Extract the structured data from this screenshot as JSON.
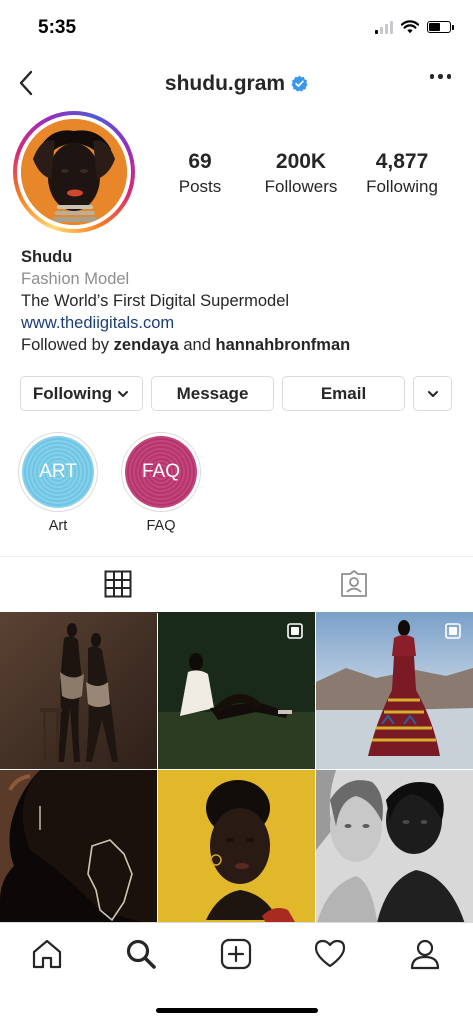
{
  "status_bar": {
    "time": "5:35"
  },
  "header": {
    "username": "shudu.gram",
    "verified": true,
    "back_icon": "chevron-left-icon",
    "more_icon": "more-horizontal-icon"
  },
  "profile": {
    "stats": [
      {
        "value": "69",
        "label": "Posts"
      },
      {
        "value": "200K",
        "label": "Followers"
      },
      {
        "value": "4,877",
        "label": "Following"
      }
    ],
    "name": "Shudu",
    "category": "Fashion Model",
    "bio": "The World’s First Digital Supermodel",
    "website": "www.thediigitals.com",
    "followed_by": {
      "prefix": "Followed by",
      "user1": "zendaya",
      "joiner": "and",
      "user2": "hannahbronfman"
    }
  },
  "actions": {
    "following": "Following",
    "message": "Message",
    "email": "Email"
  },
  "highlights": [
    {
      "cover_text": "ART",
      "label": "Art",
      "color": "#66c1e0"
    },
    {
      "cover_text": "FAQ",
      "label": "FAQ",
      "color": "#b8366e"
    }
  ],
  "tabs": [
    {
      "icon": "grid-icon",
      "active": true
    },
    {
      "icon": "tagged-icon",
      "active": false
    }
  ],
  "bottom_nav": [
    "home-icon",
    "search-icon",
    "new-post-icon",
    "activity-heart-icon",
    "profile-icon"
  ]
}
